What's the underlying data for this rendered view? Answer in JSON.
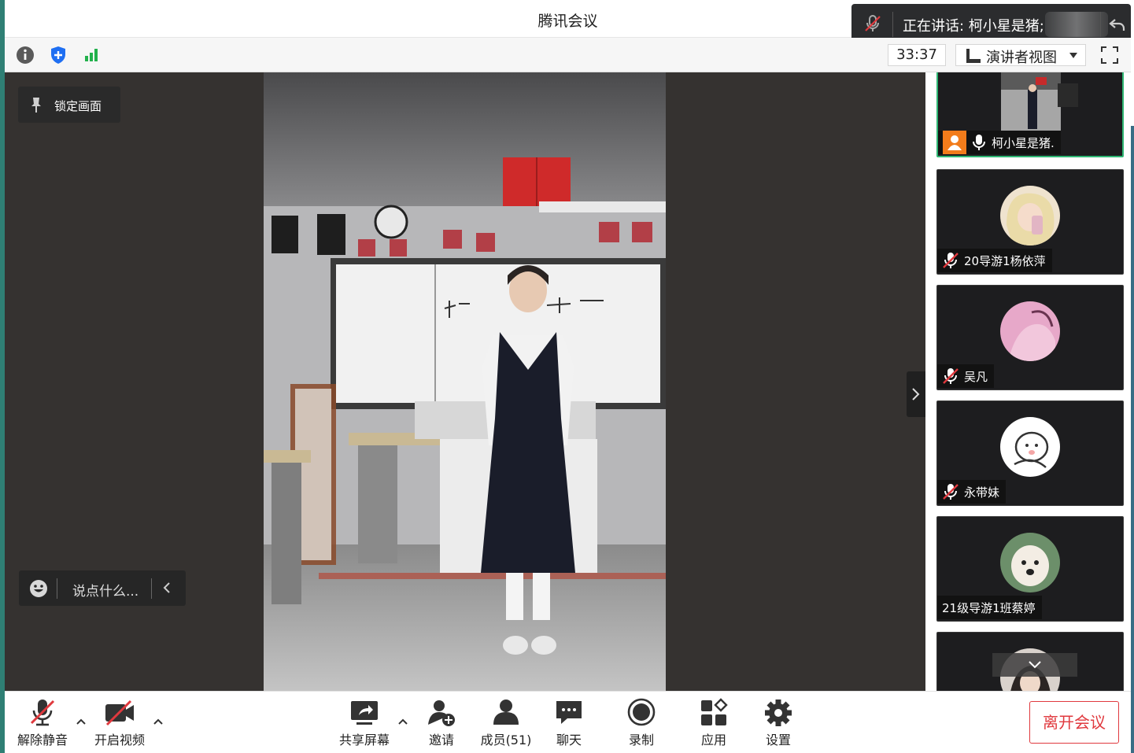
{
  "window": {
    "title": "腾讯会议"
  },
  "speaking": {
    "text": "正在讲话: 柯小星是猪;"
  },
  "toolbar": {
    "timer": "33:37",
    "view_label": "演讲者视图"
  },
  "stage": {
    "lock_label": "锁定画面",
    "chat_placeholder": "说点什么..."
  },
  "participants": [
    {
      "name": "柯小星是猪."
    },
    {
      "name": "20导游1杨依萍"
    },
    {
      "name": "吴凡"
    },
    {
      "name": "永带妹"
    },
    {
      "name": "21级导游1班蔡婷"
    }
  ],
  "controls": {
    "unmute": "解除静音",
    "start_video": "开启视频",
    "share_screen": "共享屏幕",
    "invite": "邀请",
    "members": "成员(51)",
    "chat": "聊天",
    "record": "录制",
    "apps": "应用",
    "settings": "设置",
    "leave": "离开会议"
  },
  "colors": {
    "active_border": "#2fb774",
    "leave_red": "#e0393e",
    "badge_orange": "#f27c1b",
    "stage_bg": "#353230"
  }
}
